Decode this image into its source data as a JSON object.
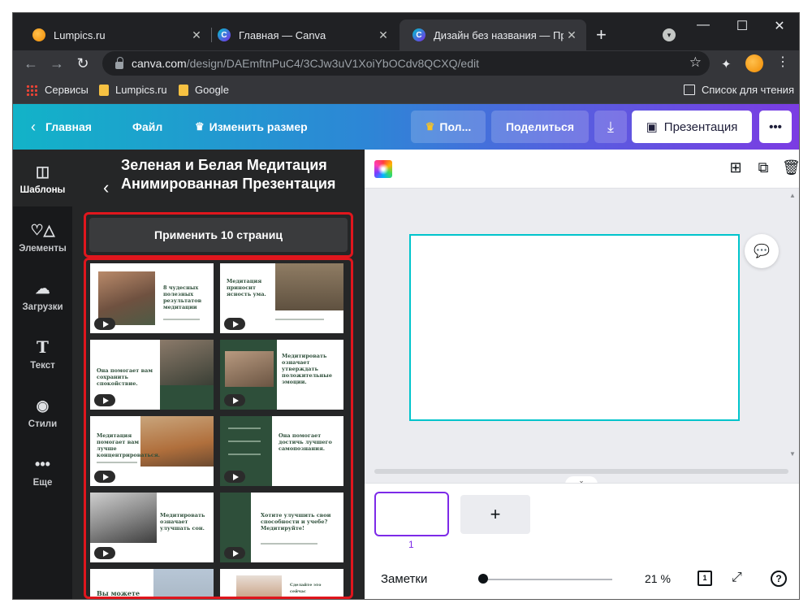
{
  "browser": {
    "tabs": [
      {
        "title": "Lumpics.ru",
        "icon": "lumpics-favicon"
      },
      {
        "title": "Главная — Canva",
        "icon": "canva-favicon"
      },
      {
        "title": "Дизайн без названия — Презе",
        "icon": "canva-favicon",
        "active": true
      }
    ],
    "url": "canva.com/design/DAEmftnPuC4/3CJw3uV1XoiYbOCdv8QCXQ/edit",
    "url_host": "canva.com",
    "url_path": "/design/DAEmftnPuC4/3CJw3uV1XoiYbOCdv8QCXQ/edit",
    "bookmarks": [
      "Сервисы",
      "Lumpics.ru",
      "Google"
    ],
    "reading_list": "Список для чтения"
  },
  "header": {
    "home": "Главная",
    "file": "Файл",
    "resize": "Изменить размер",
    "pro": "Пол...",
    "share": "Поделиться",
    "present": "Презентация",
    "more": "•••",
    "gradient": [
      "#12b3c8",
      "#7b3ce3"
    ]
  },
  "rail": [
    {
      "label": "Шаблоны",
      "icon": "templates-icon",
      "active": true
    },
    {
      "label": "Элементы",
      "icon": "elements-icon"
    },
    {
      "label": "Загрузки",
      "icon": "upload-icon"
    },
    {
      "label": "Текст",
      "icon": "text-icon"
    },
    {
      "label": "Стили",
      "icon": "palette-icon"
    },
    {
      "label": "Еще",
      "icon": "more-icon"
    }
  ],
  "panel": {
    "title": "Зеленая и Белая Медитация Анимированная Презентация",
    "apply_button": "Применить 10 страниц",
    "highlight_color": "#e0161d",
    "thumbnails": [
      {
        "text": "8 чудесных полезных результатов медитации"
      },
      {
        "text": "Медитация приносит ясность ума."
      },
      {
        "text": "Она помогает вам сохранить спокойствие."
      },
      {
        "text": "Медитировать означает утверждать положительные эмоции."
      },
      {
        "text": "Медитация помогает вам лучше концентрироваться."
      },
      {
        "text": "Она помогает достичь лучшего самопознания."
      },
      {
        "text": ""
      },
      {
        "text": "Медитировать означает улучшать сон."
      },
      {
        "text": "Хотите улучшить свои способности и учебе? Медитируйте!"
      },
      {
        "text": "Вы можете"
      },
      {
        "text": "Сделайте это сейчас"
      }
    ]
  },
  "workspace": {
    "page_number": "1",
    "add_page": "+",
    "notes": "Заметки",
    "zoom": "21 %",
    "pages_count": "1",
    "help": "?",
    "accent": "#7d2ae8",
    "selection": "#00c4cc"
  }
}
